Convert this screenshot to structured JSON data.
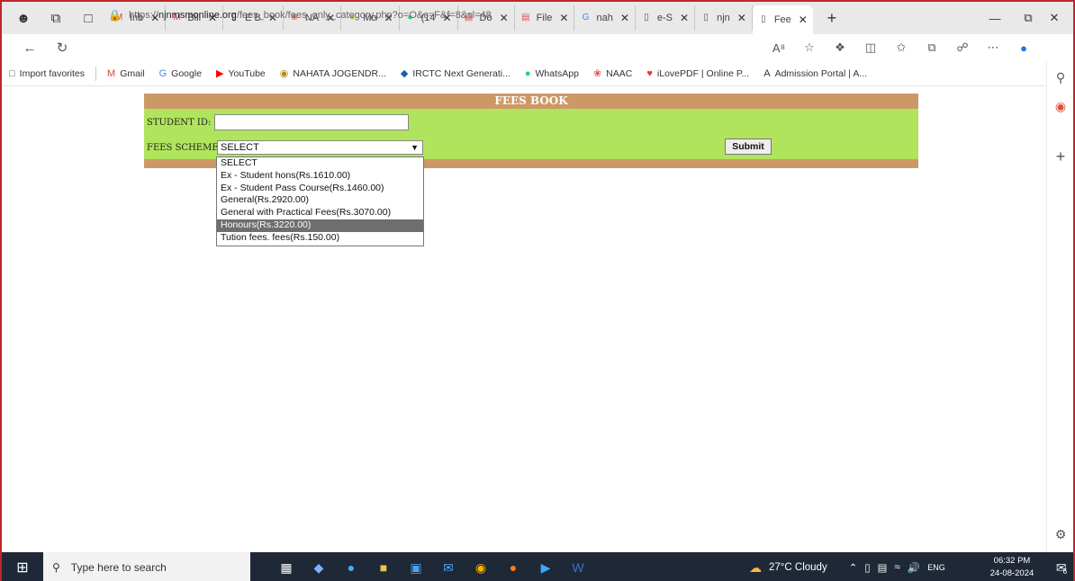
{
  "tabs": [
    {
      "label": "Inb",
      "favicon": "gmail-icon",
      "color": "#d44638"
    },
    {
      "label": "Bill",
      "favicon": "gmail-icon",
      "color": "#d44638"
    },
    {
      "label": "E B",
      "favicon": "page-icon",
      "color": "#555555"
    },
    {
      "label": "NA",
      "favicon": "naac-icon",
      "color": "#d9534f"
    },
    {
      "label": "Mo",
      "favicon": "circle-icon",
      "color": "#9acd32"
    },
    {
      "label": "(14",
      "favicon": "whatsapp-icon",
      "color": "#25d366"
    },
    {
      "label": "Do",
      "favicon": "pdf-icon",
      "color": "#d9534f"
    },
    {
      "label": "File",
      "favicon": "pdf-icon",
      "color": "#d9534f"
    },
    {
      "label": "nah",
      "favicon": "google-icon",
      "color": "#4285f4"
    },
    {
      "label": "e-S",
      "favicon": "page-icon",
      "color": "#555555"
    },
    {
      "label": "njn",
      "favicon": "page-icon",
      "color": "#555555"
    },
    {
      "label": "Fee",
      "favicon": "page-icon",
      "color": "#555555",
      "active": true
    }
  ],
  "address": {
    "prefix": "https://",
    "domain": "njnmsmonline.org",
    "path": "/fees_book/fees_only_category.php?o=O&c=F&f=8&sl=48"
  },
  "favorites": [
    {
      "label": "Import favorites",
      "icon": "import-icon"
    },
    {
      "label": "Gmail",
      "icon": "gmail-icon"
    },
    {
      "label": "Google",
      "icon": "google-icon"
    },
    {
      "label": "YouTube",
      "icon": "youtube-icon"
    },
    {
      "label": "NAHATA JOGENDR...",
      "icon": "site-icon"
    },
    {
      "label": "IRCTC Next Generati...",
      "icon": "irctc-icon"
    },
    {
      "label": "WhatsApp",
      "icon": "whatsapp-icon"
    },
    {
      "label": "NAAC",
      "icon": "naac-icon"
    },
    {
      "label": "iLovePDF | Online P...",
      "icon": "ilovepdf-icon"
    },
    {
      "label": "Admission Portal | A...",
      "icon": "angular-icon"
    }
  ],
  "form": {
    "title": "FEES BOOK",
    "student_id_label": "STUDENT ID:",
    "student_id_value": "",
    "scheme_label": "FEES SCHEME",
    "scheme_selected": "SELECT",
    "submit_label": "Submit",
    "options": [
      "SELECT",
      "Ex - Student hons(Rs.1610.00)",
      "Ex - Student Pass Course(Rs.1460.00)",
      "General(Rs.2920.00)",
      "General with Practical Fees(Rs.3070.00)",
      "Honours(Rs.3220.00)",
      "Tution fees. fees(Rs.150.00)"
    ],
    "highlighted_option_index": 5
  },
  "taskbar": {
    "search_placeholder": "Type here to search",
    "weather": "27°C  Cloudy",
    "language": "ENG",
    "time": "06:32 PM",
    "date": "24-08-2024",
    "notification_count": "6"
  },
  "colors": {
    "form_bg": "#b0e45c",
    "form_header": "#cc9966",
    "taskbar_bg": "#1f2836"
  }
}
